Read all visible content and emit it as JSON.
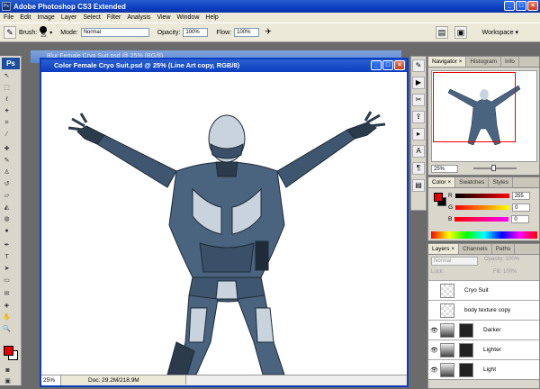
{
  "app": {
    "title": "Adobe Photoshop CS3 Extended",
    "logo": "Ps"
  },
  "window_buttons": {
    "minimize": "_",
    "maximize": "□",
    "close": "×"
  },
  "menu": [
    "File",
    "Edit",
    "Image",
    "Layer",
    "Select",
    "Filter",
    "Analysis",
    "View",
    "Window",
    "Help"
  ],
  "options": {
    "brush_label": "Brush:",
    "brush_size": "25",
    "mode_label": "Mode:",
    "mode_value": "Normal",
    "opacity_label": "Opacity:",
    "opacity_value": "100%",
    "flow_label": "Flow:",
    "flow_value": "100%",
    "workspace_label": "Workspace ▾"
  },
  "background_document": {
    "title": "Blur Female Cryo Suit.psd @ 25% (BG/8)"
  },
  "document": {
    "title": "Color Female Cryo Suit.psd @ 25% (Line Art copy, RGB/8)",
    "zoom": "25%",
    "doc_info": "Doc: 29.2M/218.9M"
  },
  "navigator": {
    "tabs": [
      "Navigator ×",
      "Histogram",
      "Info"
    ],
    "zoom": "25%"
  },
  "color_panel": {
    "tabs": [
      "Color ×",
      "Swatches",
      "Styles"
    ],
    "rows": [
      {
        "channel": "R",
        "value": "255"
      },
      {
        "channel": "G",
        "value": "0"
      },
      {
        "channel": "B",
        "value": "0"
      }
    ],
    "foreground": "#e00000",
    "background": "#000000"
  },
  "layers_panel": {
    "tabs": [
      "Layers ×",
      "Channels",
      "Paths"
    ],
    "blend_mode": "Normal",
    "opacity_label": "Opacity: 100%",
    "lock_label": "Lock:",
    "fill_label": "Fill: 100%",
    "layers": [
      {
        "name": "Cryo Suit",
        "visible": false
      },
      {
        "name": "body texture copy",
        "visible": false
      },
      {
        "name": "Darker",
        "visible": true
      },
      {
        "name": "Lighter",
        "visible": true
      },
      {
        "name": "Light",
        "visible": true
      }
    ]
  },
  "colors": {
    "accent": "#0a3ec0",
    "foreground_swatch": "#e00000",
    "suit_dark": "#3a5068",
    "suit_light": "#c8d3de"
  }
}
